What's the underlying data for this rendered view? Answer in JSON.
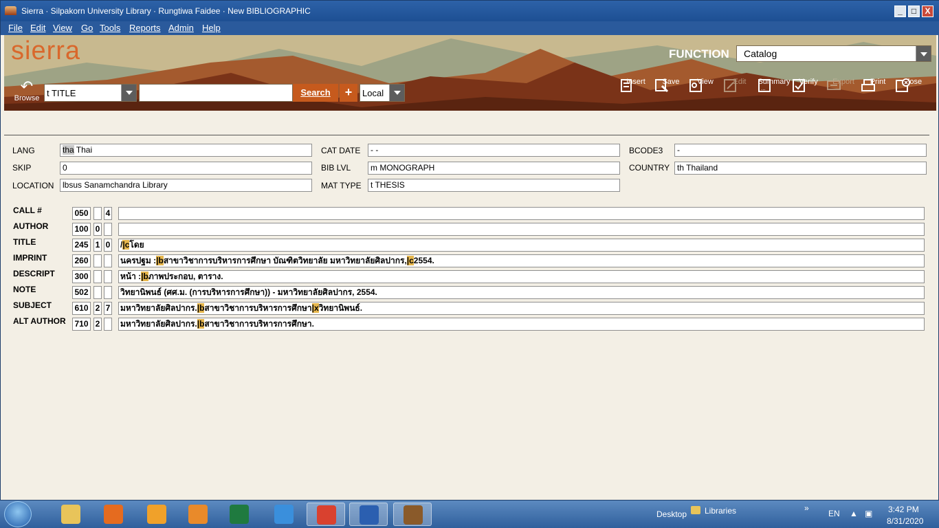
{
  "window": {
    "title": "Sierra · Silpakorn University Library · Rungtiwa Faidee · New BIBLIOGRAPHIC",
    "min_label": "_",
    "max_label": "□",
    "close_label": "X"
  },
  "menu": [
    "File",
    "Edit",
    "View",
    "Go",
    "Tools",
    "Reports",
    "Admin",
    "Help"
  ],
  "banner": {
    "logo": "sierra",
    "function_label": "FUNCTION",
    "function_value": "Catalog"
  },
  "search": {
    "browse_label": "Browse",
    "index_value": "t TITLE",
    "query_value": "",
    "search_label": "Search",
    "plus_label": "+",
    "scope_value": "Local"
  },
  "toolbar": [
    {
      "label": "Insert",
      "icon": "insert-icon",
      "enabled": true
    },
    {
      "label": "Save",
      "icon": "save-icon",
      "enabled": true
    },
    {
      "label": "View",
      "icon": "view-icon",
      "enabled": true
    },
    {
      "label": "Edit",
      "icon": "edit-icon",
      "enabled": false
    },
    {
      "label": "Summary",
      "icon": "summary-icon",
      "enabled": true
    },
    {
      "label": "Verify",
      "icon": "verify-icon",
      "enabled": true
    },
    {
      "label": "Export",
      "icon": "export-icon",
      "enabled": false
    },
    {
      "label": "Print",
      "icon": "print-icon",
      "enabled": true
    },
    {
      "label": "Close",
      "icon": "close-icon",
      "enabled": true
    }
  ],
  "fixed_fields": {
    "lang": {
      "label": "LANG",
      "code": "tha",
      "value": " Thai"
    },
    "skip": {
      "label": "SKIP",
      "value": "0"
    },
    "location": {
      "label": "LOCATION",
      "value": "lbsus  Sanamchandra Library"
    },
    "cat_date": {
      "label": "CAT DATE",
      "value": " -  -"
    },
    "bib_lvl": {
      "label": "BIB LVL",
      "value": " m  MONOGRAPH"
    },
    "mat_type": {
      "label": "MAT TYPE",
      "value": " t  THESIS"
    },
    "bcode3": {
      "label": "BCODE3",
      "value": " -"
    },
    "country": {
      "label": "COUNTRY",
      "value": " th   Thailand"
    }
  },
  "marc": [
    {
      "label": "CALL #",
      "tag": "050",
      "i1": "",
      "i2": "4",
      "d1": "",
      "sf1": "",
      "d2": "",
      "sf2": "",
      "d3": "",
      "sf3": "",
      "d4": ""
    },
    {
      "label": "AUTHOR",
      "tag": "100",
      "i1": "0",
      "i2": "",
      "d1": "",
      "sf1": "",
      "d2": "",
      "sf2": "",
      "d3": "",
      "sf3": "",
      "d4": ""
    },
    {
      "label": "TITLE",
      "tag": "245",
      "i1": "1",
      "i2": "0",
      "d1": "/",
      "sf1": "|c",
      "d2": "โดย",
      "sf2": "",
      "d3": "",
      "sf3": "",
      "d4": ""
    },
    {
      "label": "IMPRINT",
      "tag": "260",
      "i1": "",
      "i2": "",
      "d1": "นครปฐม :",
      "sf1": "|b",
      "d2": "สาขาวิชาการบริหารการศึกษา บัณฑิตวิทยาลัย มหาวิทยาลัยศิลปากร,",
      "sf2": "|c",
      "d3": "2554.",
      "sf3": "",
      "d4": ""
    },
    {
      "label": "DESCRIPT",
      "tag": "300",
      "i1": "",
      "i2": "",
      "d1": "หน้า :",
      "sf1": "|b",
      "d2": "ภาพประกอบ, ตาราง.",
      "sf2": "",
      "d3": "",
      "sf3": "",
      "d4": ""
    },
    {
      "label": "NOTE",
      "tag": "502",
      "i1": "",
      "i2": "",
      "d1": "วิทยานิพนธ์ (ศศ.ม. (การบริหารการศึกษา)) - มหาวิทยาลัยศิลปากร, 2554.",
      "sf1": "",
      "d2": "",
      "sf2": "",
      "d3": "",
      "sf3": "",
      "d4": ""
    },
    {
      "label": "SUBJECT",
      "tag": "610",
      "i1": "2",
      "i2": "7",
      "d1": "มหาวิทยาลัยศิลปากร.",
      "sf1": "|b",
      "d2": "สาขาวิชาการบริหารการศึกษา",
      "sf2": "|x",
      "d3": "วิทยานิพนธ์.",
      "sf3": "",
      "d4": ""
    },
    {
      "label": "ALT AUTHOR",
      "tag": "710",
      "i1": "2",
      "i2": "",
      "d1": "มหาวิทยาลัยศิลปากร.",
      "sf1": "|b",
      "d2": "สาขาวิชาการบริหารการศึกษา.",
      "sf2": "",
      "d3": "",
      "sf3": "",
      "d4": ""
    }
  ],
  "taskbar": {
    "apps": [
      {
        "name": "windows-explorer-icon",
        "color": "#e8c45a",
        "active": false
      },
      {
        "name": "firefox-icon",
        "color": "#e56b1f",
        "active": false
      },
      {
        "name": "winamp-icon",
        "color": "#f0a12a",
        "active": false
      },
      {
        "name": "media-player-icon",
        "color": "#e98a2a",
        "active": false
      },
      {
        "name": "excel-icon",
        "color": "#1f7a3f",
        "active": false
      },
      {
        "name": "internet-explorer-icon",
        "color": "#3a8fdc",
        "active": false
      },
      {
        "name": "chrome-icon",
        "color": "#d9412f",
        "active": true
      },
      {
        "name": "word-icon",
        "color": "#2b5fb0",
        "active": true
      },
      {
        "name": "sierra-app-icon",
        "color": "#8a5a2a",
        "active": true
      }
    ],
    "desktop_label": "Desktop",
    "libraries_label": "Libraries",
    "chevron": "»",
    "lang": "EN",
    "time": "3:42 PM",
    "date": "8/31/2020"
  }
}
